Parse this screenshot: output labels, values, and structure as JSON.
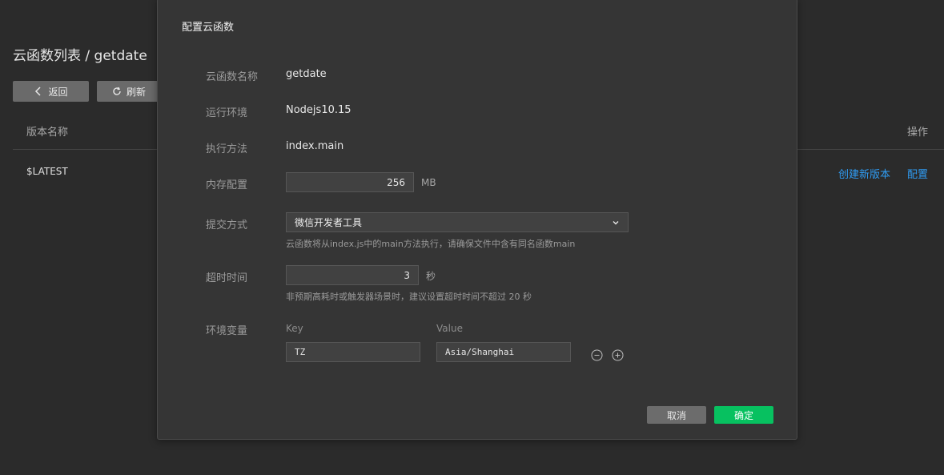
{
  "page": {
    "title": "云函数列表 / getdate",
    "back_label": "返回",
    "refresh_label": "刷新"
  },
  "table": {
    "col_version": "版本名称",
    "col_action": "操作",
    "rows": [
      {
        "version": "$LATEST",
        "action_create": "创建新版本",
        "action_config": "配置"
      }
    ]
  },
  "modal": {
    "title": "配置云函数",
    "fields": {
      "name_label": "云函数名称",
      "name_value": "getdate",
      "runtime_label": "运行环境",
      "runtime_value": "Nodejs10.15",
      "handler_label": "执行方法",
      "handler_value": "index.main",
      "memory_label": "内存配置",
      "memory_value": "256",
      "memory_unit": "MB",
      "submit_label": "提交方式",
      "submit_value": "微信开发者工具",
      "submit_hint": "云函数将从index.js中的main方法执行，请确保文件中含有同名函数main",
      "timeout_label": "超时时间",
      "timeout_value": "3",
      "timeout_unit": "秒",
      "timeout_hint": "非预期高耗时或触发器场景时，建议设置超时时间不超过 20 秒",
      "env_label": "环境变量",
      "env_key_header": "Key",
      "env_value_header": "Value",
      "env_key": "TZ",
      "env_value": "Asia/Shanghai"
    },
    "cancel_label": "取消",
    "ok_label": "确定"
  },
  "colors": {
    "accent_link": "#2f9cf3",
    "primary_button": "#07c160",
    "background": "#2b2b2b",
    "modal_bg": "#353535"
  }
}
